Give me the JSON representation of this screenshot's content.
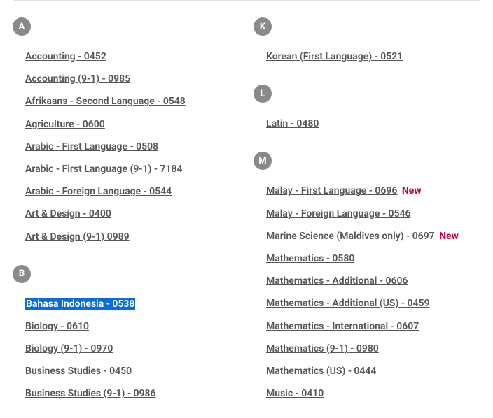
{
  "new_label": "New",
  "left": [
    {
      "letter": "A",
      "items": [
        {
          "label": "Accounting - 0452"
        },
        {
          "label": "Accounting (9-1) - 0985"
        },
        {
          "label": "Afrikaans - Second Language - 0548"
        },
        {
          "label": "Agriculture - 0600"
        },
        {
          "label": "Arabic - First Language - 0508"
        },
        {
          "label": "Arabic - First Language (9-1) - 7184"
        },
        {
          "label": "Arabic - Foreign Language - 0544"
        },
        {
          "label": "Art & Design - 0400"
        },
        {
          "label": "Art & Design (9-1) 0989"
        }
      ]
    },
    {
      "letter": "B",
      "items": [
        {
          "label": "Bahasa Indonesia - 0538",
          "highlighted": true
        },
        {
          "label": "Biology - 0610"
        },
        {
          "label": "Biology (9-1) - 0970"
        },
        {
          "label": "Business Studies - 0450"
        },
        {
          "label": "Business Studies (9-1) - 0986"
        }
      ]
    }
  ],
  "right": [
    {
      "letter": "K",
      "items": [
        {
          "label": "Korean (First Language) - 0521"
        }
      ]
    },
    {
      "letter": "L",
      "items": [
        {
          "label": "Latin - 0480"
        }
      ]
    },
    {
      "letter": "M",
      "items": [
        {
          "label": "Malay - First Language - 0696",
          "new": true
        },
        {
          "label": "Malay - Foreign Language - 0546"
        },
        {
          "label": "Marine Science (Maldives only) - 0697",
          "new": true
        },
        {
          "label": "Mathematics - 0580"
        },
        {
          "label": "Mathematics - Additional - 0606"
        },
        {
          "label": "Mathematics - Additional (US) - 0459"
        },
        {
          "label": "Mathematics - International - 0607"
        },
        {
          "label": "Mathematics (9-1) - 0980"
        },
        {
          "label": "Mathematics (US) - 0444"
        },
        {
          "label": "Music - 0410"
        }
      ]
    }
  ]
}
